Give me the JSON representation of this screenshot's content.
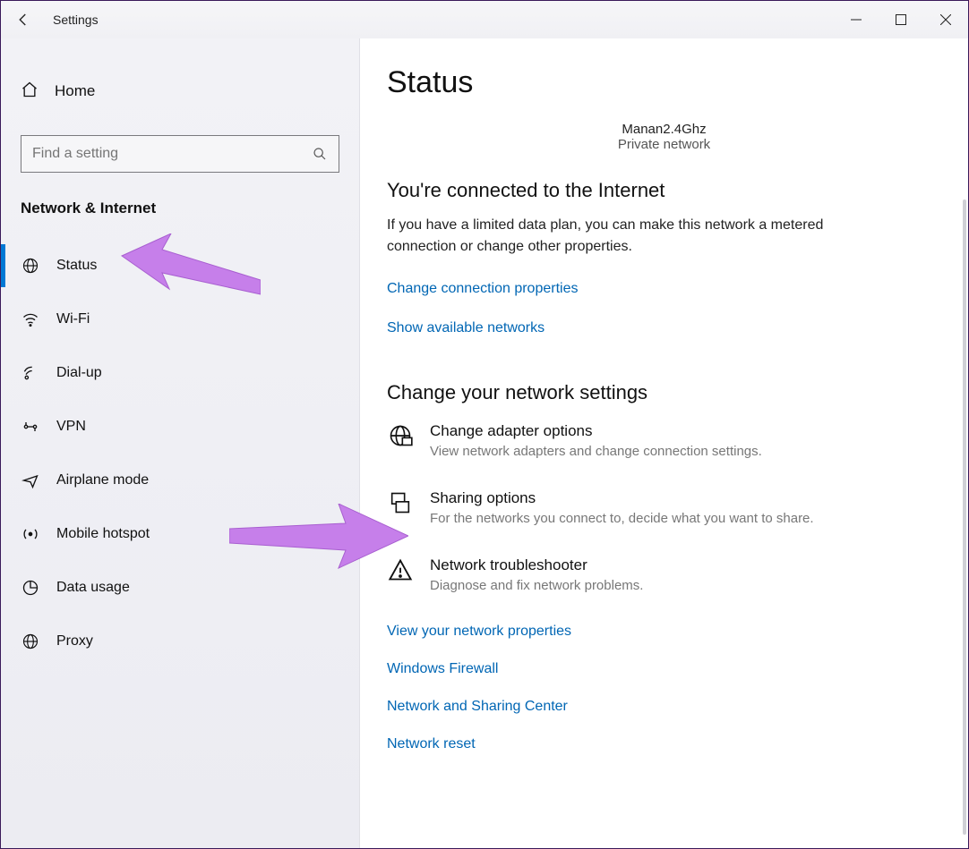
{
  "window": {
    "title": "Settings"
  },
  "sidebar": {
    "home": "Home",
    "search_placeholder": "Find a setting",
    "category": "Network & Internet",
    "items": [
      {
        "label": "Status",
        "active": true
      },
      {
        "label": "Wi-Fi"
      },
      {
        "label": "Dial-up"
      },
      {
        "label": "VPN"
      },
      {
        "label": "Airplane mode"
      },
      {
        "label": "Mobile hotspot"
      },
      {
        "label": "Data usage"
      },
      {
        "label": "Proxy"
      }
    ]
  },
  "main": {
    "title": "Status",
    "network": {
      "name": "Manan2.4Ghz",
      "type": "Private network"
    },
    "connected_heading": "You're connected to the Internet",
    "connected_body": "If you have a limited data plan, you can make this network a metered connection or change other properties.",
    "link_change_props": "Change connection properties",
    "link_show_networks": "Show available networks",
    "change_settings_heading": "Change your network settings",
    "options": [
      {
        "title": "Change adapter options",
        "desc": "View network adapters and change connection settings."
      },
      {
        "title": "Sharing options",
        "desc": "For the networks you connect to, decide what you want to share."
      },
      {
        "title": "Network troubleshooter",
        "desc": "Diagnose and fix network problems."
      }
    ],
    "bottom_links": [
      "View your network properties",
      "Windows Firewall",
      "Network and Sharing Center",
      "Network reset"
    ]
  }
}
